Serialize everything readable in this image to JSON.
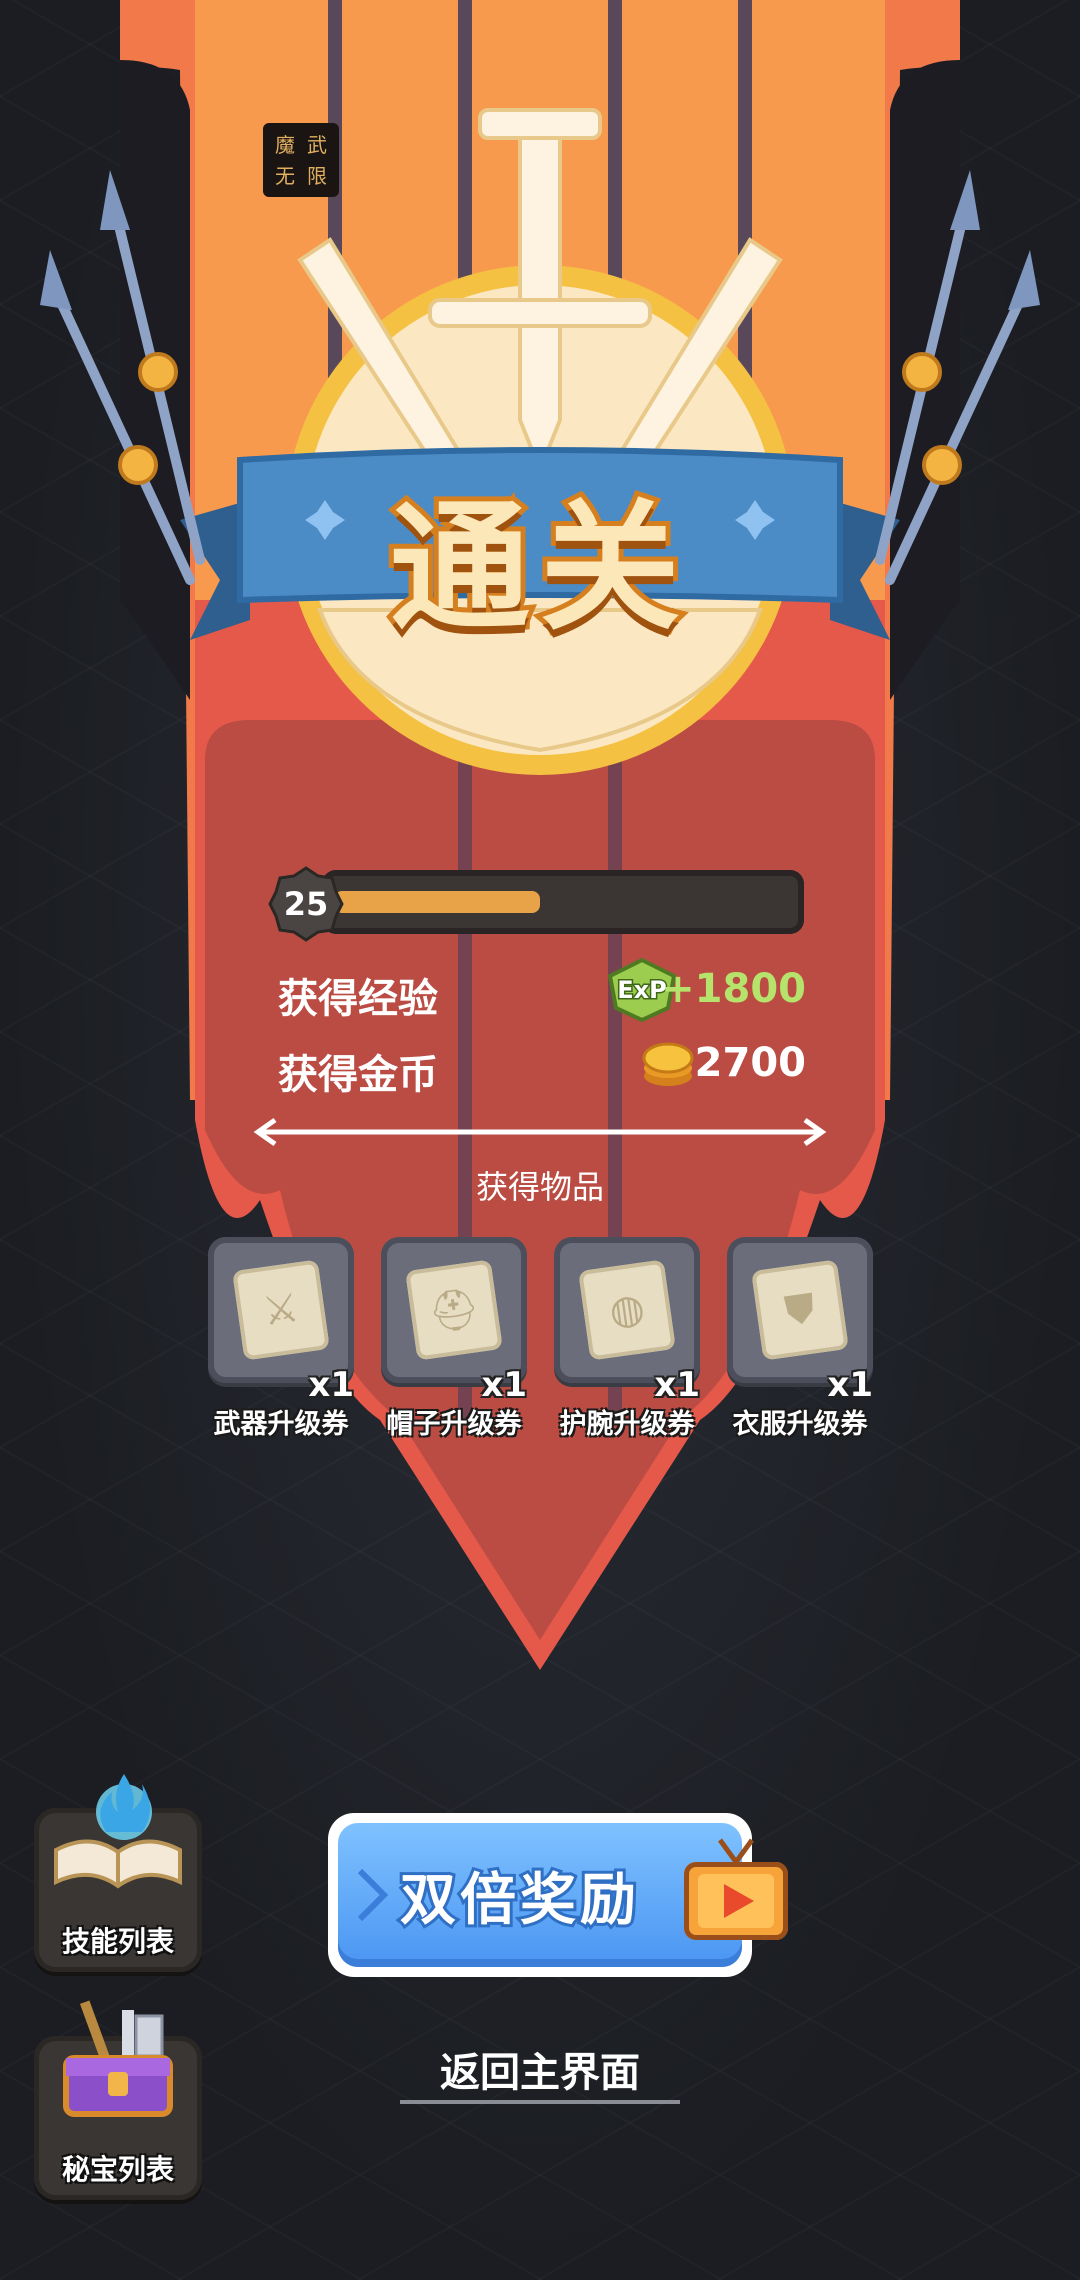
{
  "header": {
    "logo_chars": [
      "魔",
      "武",
      "无",
      "限"
    ]
  },
  "banner": {
    "title": "通关"
  },
  "progress": {
    "level": "25",
    "fill_fraction": 0.45
  },
  "rewards": {
    "exp_label": "获得经验",
    "exp_icon_text": "ExP",
    "exp_value": "+1800",
    "gold_label": "获得金币",
    "gold_value": "2700",
    "items_label": "获得物品"
  },
  "items": [
    {
      "name": "武器升级券",
      "qty": "x1",
      "icon": "sword-icon"
    },
    {
      "name": "帽子升级券",
      "qty": "x1",
      "icon": "helmet-icon"
    },
    {
      "name": "护腕升级券",
      "qty": "x1",
      "icon": "bracer-icon"
    },
    {
      "name": "衣服升级券",
      "qty": "x1",
      "icon": "armor-icon"
    }
  ],
  "side_buttons": {
    "skills_label": "技能列表",
    "treasure_label": "秘宝列表"
  },
  "actions": {
    "double_reward_label": "双倍奖励",
    "return_label": "返回主界面"
  },
  "colors": {
    "banner_red": "#e5594a",
    "banner_orange": "#f89a4e",
    "ribbon_blue": "#4b8cc7",
    "exp_green": "#b5e36b",
    "button_blue": "#4a95f2"
  }
}
